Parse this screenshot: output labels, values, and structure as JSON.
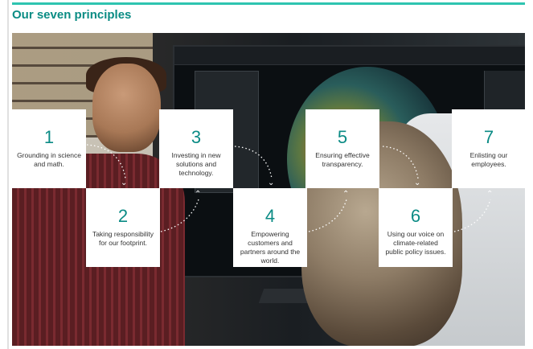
{
  "header": {
    "title": "Our seven principles"
  },
  "principles": [
    {
      "number": "1",
      "text": "Grounding in science and math."
    },
    {
      "number": "2",
      "text": "Taking responsibility for our footprint."
    },
    {
      "number": "3",
      "text": "Investing in new solutions and technology."
    },
    {
      "number": "4",
      "text": "Empowering customers and partners around the world."
    },
    {
      "number": "5",
      "text": "Ensuring effective transparency."
    },
    {
      "number": "6",
      "text": "Using our voice on climate-related public policy issues."
    },
    {
      "number": "7",
      "text": "Enlisting our employees."
    }
  ],
  "colors": {
    "accent": "#0b8b85",
    "rule": "#2ec4b0",
    "card": "#ffffff"
  },
  "icons": {
    "down": "chevron-down-icon",
    "up": "chevron-up-icon"
  }
}
